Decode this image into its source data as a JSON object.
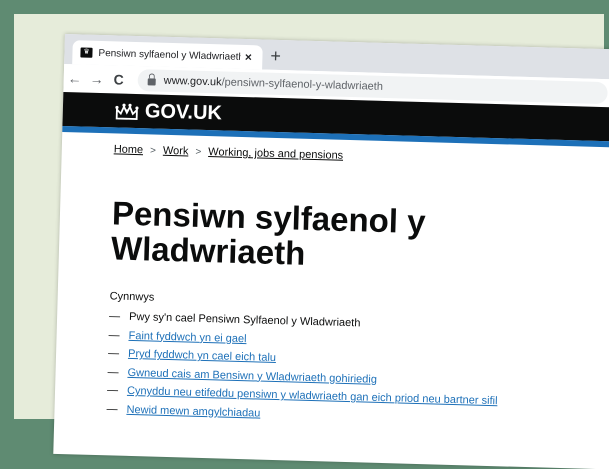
{
  "browser": {
    "tab_title": "Pensiwn sylfaenol y Wladwriaeth",
    "tab_close": "×",
    "new_tab": "+",
    "back": "←",
    "forward": "→",
    "reload": "C",
    "url_domain": "www.gov.uk",
    "url_path": "/pensiwn-sylfaenol-y-wladwriaeth"
  },
  "header": {
    "logo_text": "GOV.UK"
  },
  "breadcrumb": {
    "items": [
      "Home",
      "Work",
      "Working, jobs and pensions"
    ],
    "separator": ">"
  },
  "page": {
    "title": "Pensiwn sylfaenol y Wladwriaeth"
  },
  "contents": {
    "heading": "Cynnwys",
    "items": [
      {
        "text": "Pwy sy'n cael Pensiwn Sylfaenol y Wladwriaeth",
        "current": true
      },
      {
        "text": "Faint fyddwch yn ei gael",
        "current": false
      },
      {
        "text": "Pryd fyddwch yn cael eich talu",
        "current": false
      },
      {
        "text": "Gwneud cais am Bensiwn y Wladwriaeth gohiriedig",
        "current": false
      },
      {
        "text": "Cynyddu neu etifeddu pensiwn y wladwriaeth gan eich priod neu bartner sifil",
        "current": false
      },
      {
        "text": "Newid mewn amgylchiadau",
        "current": false
      }
    ],
    "dash": "—"
  },
  "colors": {
    "page_background": "#5f8b72",
    "govuk_black": "#0b0c0c",
    "govuk_blue": "#1d70b8",
    "link": "#1d70b8"
  }
}
